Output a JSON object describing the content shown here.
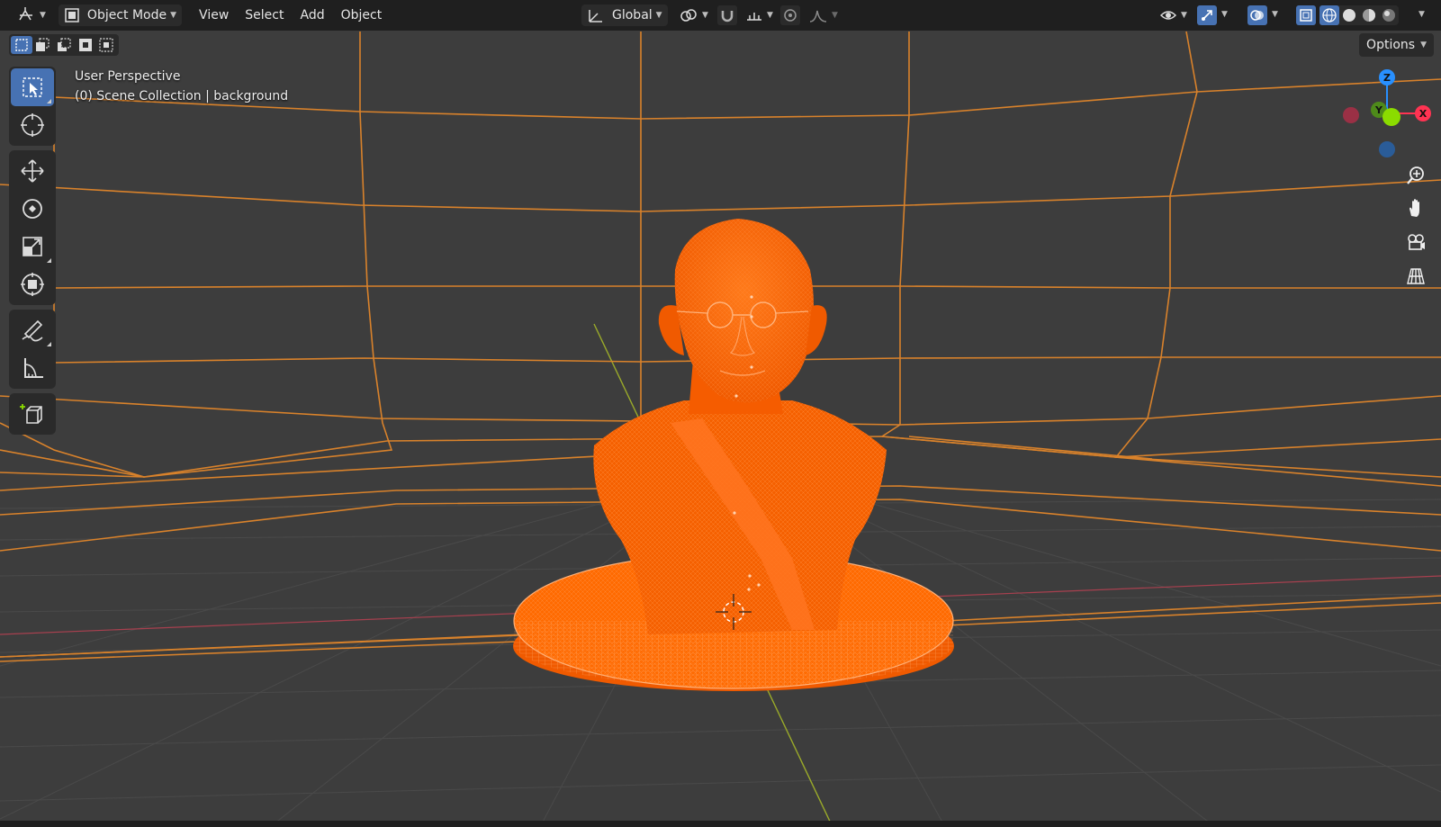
{
  "header": {
    "mode_label": "Object Mode",
    "menus": [
      "View",
      "Select",
      "Add",
      "Object"
    ],
    "transform_orientation": "Global"
  },
  "viewport": {
    "view_name": "User Perspective",
    "collection_line": "(0) Scene Collection | background"
  },
  "gizmo": {
    "z_label": "Z",
    "y_label": "Y",
    "x_label": "X"
  },
  "options_label": "Options",
  "colors": {
    "header_bg": "#1f1f1f",
    "viewport_bg": "#3d3d3d",
    "accent_blue": "#4772b3",
    "selection_orange": "#ff6a00",
    "wire_orange": "#e08a2c",
    "axis_red": "#ff3352",
    "axis_green": "#8bdc00",
    "axis_blue": "#2890ff"
  },
  "toolbar": {
    "tools": [
      "select-box",
      "cursor",
      "move",
      "rotate",
      "scale",
      "transform",
      "annotate",
      "measure",
      "add-cube"
    ]
  },
  "nav_buttons": [
    "zoom-icon",
    "pan-hand-icon",
    "camera-icon",
    "grid-perspective-icon"
  ]
}
